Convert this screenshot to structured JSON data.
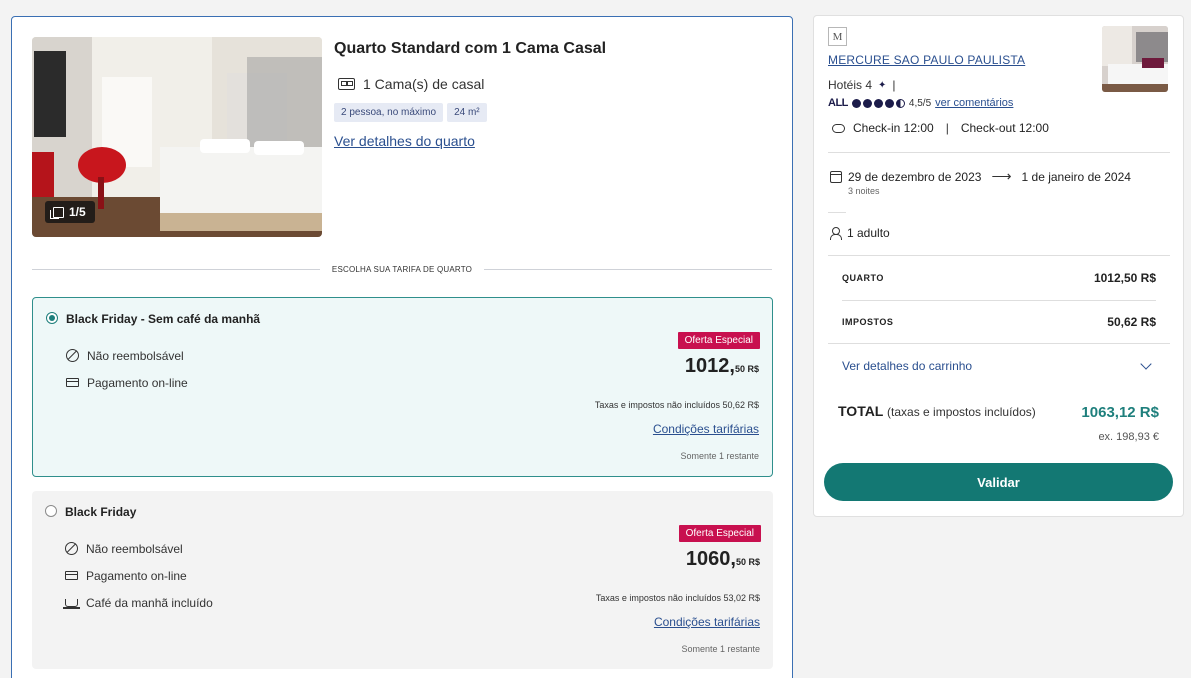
{
  "room": {
    "title": "Quarto Standard com 1 Cama Casal",
    "bed": "1 Cama(s) de casal",
    "chips": [
      "2 pessoa, no máximo",
      "24 m²"
    ],
    "details_link": "Ver detalhes do quarto",
    "photo_counter": "1/5"
  },
  "rates_divider": "ESCOLHA SUA TARIFA DE QUARTO",
  "rates": [
    {
      "name": "Black Friday - Sem café da manhã",
      "selected": true,
      "features": [
        {
          "icon": "no-refund-icon",
          "label": "Não reembolsável"
        },
        {
          "icon": "credit-card-icon",
          "label": "Pagamento on-line"
        }
      ],
      "badge": "Oferta Especial",
      "price_main": "1012,",
      "price_cents": "50 R$",
      "tax_note": "Taxas e impostos não incluídos 50,62 R$",
      "conditions_link": "Condições tarifárias",
      "remaining": "Somente 1 restante"
    },
    {
      "name": "Black Friday",
      "selected": false,
      "features": [
        {
          "icon": "no-refund-icon",
          "label": "Não reembolsável"
        },
        {
          "icon": "credit-card-icon",
          "label": "Pagamento on-line"
        },
        {
          "icon": "breakfast-icon",
          "label": "Café da manhã incluído"
        }
      ],
      "badge": "Oferta Especial",
      "price_main": "1060,",
      "price_cents": "50 R$",
      "tax_note": "Taxas e impostos não incluídos 53,02 R$",
      "conditions_link": "Condições tarifárias",
      "remaining": "Somente 1 restante"
    }
  ],
  "summary": {
    "logo_letter": "M",
    "hotel_name": "MERCURE SAO PAULO PAULISTA",
    "category": "Hotéis 4",
    "category_sep": "|",
    "rating_brand": "ALL",
    "rating_value": "4,5/5",
    "reviews_link": "ver comentários",
    "checkin": "Check-in 12:00",
    "checkout": "Check-out 12:00",
    "checkin_sep": "|",
    "date_from": "29 de dezembro de 2023",
    "date_to": "1 de janeiro de 2024",
    "nights": "3 noites",
    "guests": "1 adulto",
    "room_label": "QUARTO",
    "room_value": "1012,50 R$",
    "tax_label": "IMPOSTOS",
    "tax_value": "50,62 R$",
    "cart_link": "Ver detalhes do carrinho",
    "total_label": "TOTAL",
    "total_sub": "(taxas e impostos incluídos)",
    "total_value": "1063,12 R$",
    "total_ex": "ex. 198,93 €",
    "validate": "Validar"
  },
  "colors": {
    "accent": "#137873",
    "link": "#2a4f8f",
    "badge": "#c8104f",
    "selected_bg": "#eef8f8"
  }
}
